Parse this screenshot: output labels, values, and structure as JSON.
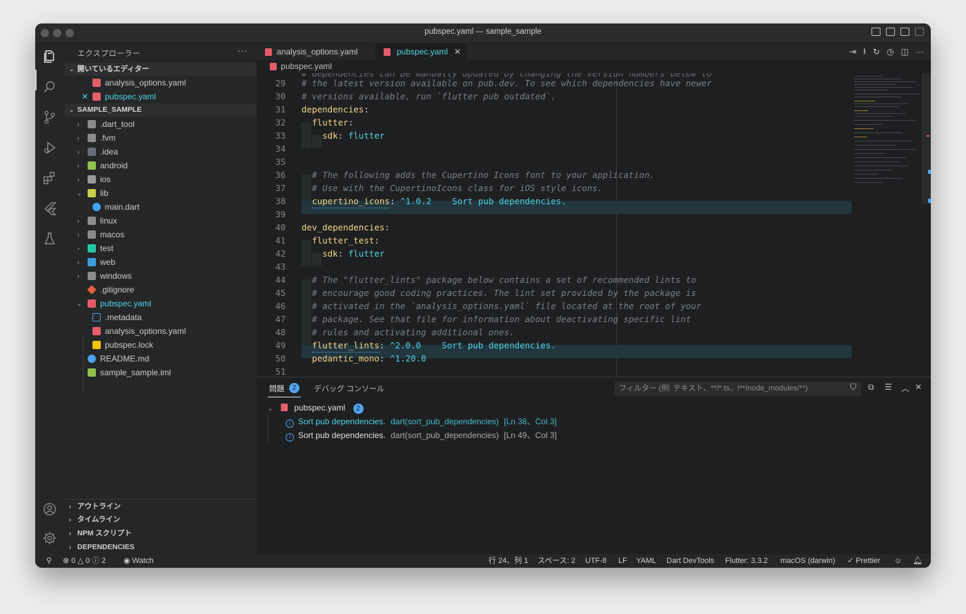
{
  "window": {
    "title": "pubspec.yaml — sample_sample"
  },
  "explorer": {
    "title": "エクスプローラー",
    "open_editors_label": "開いているエディター",
    "open_editors": [
      {
        "name": "analysis_options.yaml",
        "active": false
      },
      {
        "name": "pubspec.yaml",
        "active": true
      }
    ],
    "project_label": "SAMPLE_SAMPLE",
    "tree": [
      {
        "name": ".dart_tool",
        "type": "folder",
        "expanded": false
      },
      {
        "name": ".fvm",
        "type": "folder",
        "expanded": false
      },
      {
        "name": ".idea",
        "type": "folder",
        "expanded": false
      },
      {
        "name": "android",
        "type": "folder",
        "expanded": false
      },
      {
        "name": "ios",
        "type": "folder",
        "expanded": false
      },
      {
        "name": "lib",
        "type": "folder",
        "expanded": true
      },
      {
        "name": "main.dart",
        "type": "file-dart",
        "level": 2
      },
      {
        "name": "linux",
        "type": "folder",
        "expanded": false
      },
      {
        "name": "macos",
        "type": "folder",
        "expanded": false
      },
      {
        "name": "test",
        "type": "folder",
        "expanded": false
      },
      {
        "name": "web",
        "type": "folder",
        "expanded": false
      },
      {
        "name": "windows",
        "type": "folder",
        "expanded": false
      },
      {
        "name": ".gitignore",
        "type": "file-git"
      },
      {
        "name": "pubspec.yaml",
        "type": "file-yaml",
        "expanded": true,
        "selected": true
      },
      {
        "name": ".metadata",
        "type": "file-plain",
        "level": 2
      },
      {
        "name": "analysis_options.yaml",
        "type": "file-yaml",
        "level": 2
      },
      {
        "name": "pubspec.lock",
        "type": "file-lock",
        "level": 2
      },
      {
        "name": "README.md",
        "type": "file-info"
      },
      {
        "name": "sample_sample.iml",
        "type": "file-iml"
      }
    ],
    "bottom_sections": [
      "アウトライン",
      "タイムライン",
      "NPM スクリプト",
      "DEPENDENCIES"
    ]
  },
  "tabs": [
    {
      "label": "analysis_options.yaml",
      "active": false
    },
    {
      "label": "pubspec.yaml",
      "active": true
    }
  ],
  "breadcrumb": "pubspec.yaml",
  "editor": {
    "top_partial": "# dependencies can be manually updated by changing the version numbers below to",
    "lines": [
      {
        "n": "29",
        "text": "# the latest version available on pub.dev. To see which dependencies have newer"
      },
      {
        "n": "30",
        "text": "# versions available, run `flutter pub outdated`."
      },
      {
        "n": "31",
        "text": "dependencies:"
      },
      {
        "n": "32",
        "text": "  flutter:"
      },
      {
        "n": "33",
        "text": "    sdk: flutter"
      },
      {
        "n": "34",
        "text": ""
      },
      {
        "n": "35",
        "text": ""
      },
      {
        "n": "36",
        "text": "  # The following adds the Cupertino Icons font to your application."
      },
      {
        "n": "37",
        "text": "  # Use with the CupertinoIcons class for iOS style icons."
      },
      {
        "n": "38",
        "text": "  cupertino_icons: ^1.0.2"
      },
      {
        "n": "39",
        "text": ""
      },
      {
        "n": "40",
        "text": "dev_dependencies:"
      },
      {
        "n": "41",
        "text": "  flutter_test:"
      },
      {
        "n": "42",
        "text": "    sdk: flutter"
      },
      {
        "n": "43",
        "text": ""
      },
      {
        "n": "44",
        "text": "  # The \"flutter_lints\" package below contains a set of recommended lints to"
      },
      {
        "n": "45",
        "text": "  # encourage good coding practices. The lint set provided by the package is"
      },
      {
        "n": "46",
        "text": "  # activated in the `analysis_options.yaml` file located at the root of your"
      },
      {
        "n": "47",
        "text": "  # package. See that file for information about deactivating specific lint"
      },
      {
        "n": "48",
        "text": "  # rules and activating additional ones."
      },
      {
        "n": "49",
        "text": "  flutter_lints: ^2.0.0"
      },
      {
        "n": "50",
        "text": "  pedantic_mono: ^1.20.0"
      },
      {
        "n": "51",
        "text": ""
      }
    ],
    "inline_hint": "Sort pub dependencies."
  },
  "panel": {
    "tabs": [
      {
        "label": "問題",
        "count": "2",
        "active": true
      },
      {
        "label": "デバッグ コンソール",
        "active": false
      }
    ],
    "filter_placeholder": "フィルター (例: テキスト、**/*.ts、!**/node_modules/**)",
    "file": "pubspec.yaml",
    "file_count": "2",
    "problems": [
      {
        "message": "Sort pub dependencies.",
        "source": "dart(sort_pub_dependencies)",
        "location": "[Ln 38、Col 3]",
        "selected": true
      },
      {
        "message": "Sort pub dependencies.",
        "source": "dart(sort_pub_dependencies)",
        "location": "[Ln 49、Col 3]",
        "selected": false
      }
    ]
  },
  "status": {
    "errors": "0",
    "warnings": "0",
    "infos": "2",
    "watch": "Watch",
    "position": "行 24、列 1",
    "spaces": "スペース: 2",
    "encoding": "UTF-8",
    "eol": "LF",
    "language": "YAML",
    "devtools": "Dart DevTools",
    "flutter": "Flutter: 3.3.2",
    "device": "macOS (darwin)",
    "prettier": "✓ Prettier"
  },
  "colors": {
    "accent": "#4fd3e6",
    "key": "#f3d58a",
    "comment": "#7a7f86",
    "yaml_icon": "#e35d6a",
    "info": "#4fa3f0"
  }
}
